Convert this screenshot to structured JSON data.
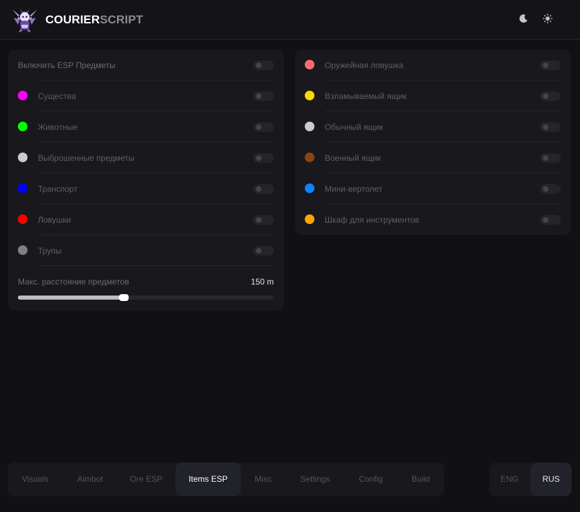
{
  "header": {
    "brand_part1": "COURIER",
    "brand_part2": "SCRIPT"
  },
  "left_panel": {
    "enable_label": "Включить ESP Предметы",
    "items": [
      {
        "label": "Существа",
        "color": "#ff00ff"
      },
      {
        "label": "Животные",
        "color": "#00ff00"
      },
      {
        "label": "Выброшенные предметы",
        "color": "#cccccc"
      },
      {
        "label": "Транспорт",
        "color": "#0000ff"
      },
      {
        "label": "Ловушки",
        "color": "#ff0000"
      },
      {
        "label": "Трупы",
        "color": "#808080"
      }
    ],
    "slider": {
      "label": "Макс. расстояние предметов",
      "value_text": "150 m",
      "fraction": 0.41
    }
  },
  "right_panel": {
    "items": [
      {
        "label": "Оружейная ловушка",
        "color": "#ff6b6b"
      },
      {
        "label": "Взламываемый ящик",
        "color": "#ffd700"
      },
      {
        "label": "Обычный ящик",
        "color": "#cccccc"
      },
      {
        "label": "Военный ящик",
        "color": "#8b4513"
      },
      {
        "label": "Мини-вертолет",
        "color": "#0a84ff"
      },
      {
        "label": "Шкаф для инструментов",
        "color": "#ffa500"
      }
    ]
  },
  "tabs": [
    {
      "label": "Visuals",
      "active": false
    },
    {
      "label": "Aimbot",
      "active": false
    },
    {
      "label": "Ore ESP",
      "active": false
    },
    {
      "label": "Items ESP",
      "active": true
    },
    {
      "label": "Misc",
      "active": false
    },
    {
      "label": "Settings",
      "active": false
    },
    {
      "label": "Config",
      "active": false
    },
    {
      "label": "Build",
      "active": false
    }
  ],
  "languages": [
    {
      "label": "ENG",
      "active": false
    },
    {
      "label": "RUS",
      "active": true
    }
  ],
  "icons": {
    "logo": "winged-creature-logo-icon",
    "dark_theme": "moon-icon",
    "light_theme": "sun-icon"
  }
}
